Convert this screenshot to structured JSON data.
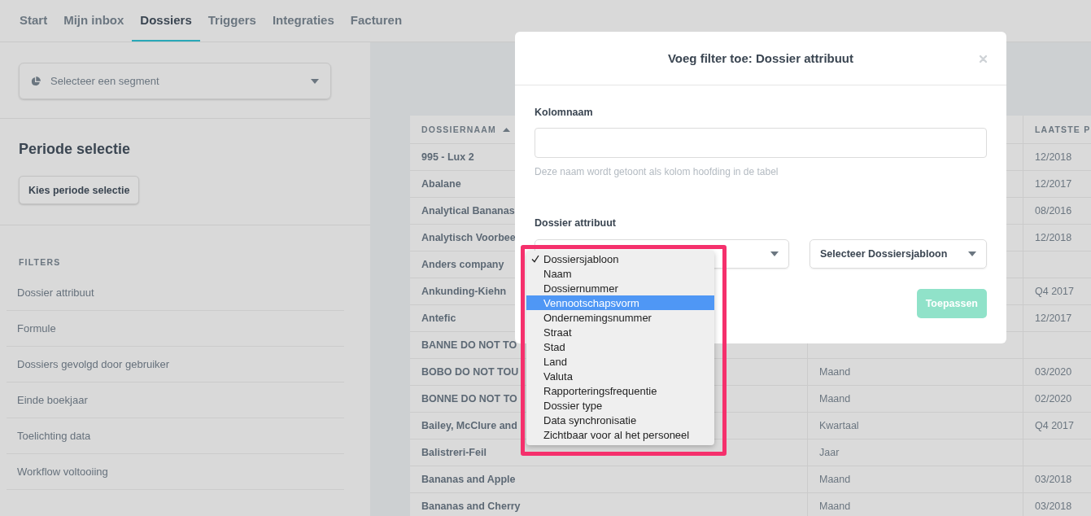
{
  "nav": {
    "tabs": [
      {
        "label": "Start",
        "selected": false
      },
      {
        "label": "Mijn inbox",
        "selected": false
      },
      {
        "label": "Dossiers",
        "selected": true
      },
      {
        "label": "Triggers",
        "selected": false
      },
      {
        "label": "Integraties",
        "selected": false
      },
      {
        "label": "Facturen",
        "selected": false
      }
    ]
  },
  "sidebar": {
    "segment_select": {
      "placeholder": "Selecteer een segment"
    },
    "period": {
      "title": "Periode selectie",
      "button": "Kies periode selectie"
    },
    "filters": {
      "title": "FILTERS",
      "items": [
        "Dossier attribuut",
        "Formule",
        "Dossiers gevolgd door gebruiker",
        "Einde boekjaar",
        "Toelichting data",
        "Workflow voltooiing"
      ]
    }
  },
  "table": {
    "columns": [
      {
        "label": "DOSSIERNAAM",
        "sorted": true
      },
      {
        "label": "LAATSTE P"
      }
    ],
    "rows": [
      {
        "dossiernaam": "995 - Lux 2",
        "column_3": "12/2018"
      },
      {
        "dossiernaam": "Abalane",
        "column_3": "12/2017"
      },
      {
        "dossiernaam": "Analytical Bananas",
        "column_3": "08/2016"
      },
      {
        "dossiernaam": "Analytisch Voorbee",
        "column_3": "12/2018"
      },
      {
        "dossiernaam": "Anders company"
      },
      {
        "dossiernaam": "Ankunding-Kiehn",
        "column_3": "Q4 2017"
      },
      {
        "dossiernaam": "Antefic",
        "column_3": "12/2017"
      },
      {
        "dossiernaam": "BANNE DO NOT TO"
      },
      {
        "dossiernaam": "BOBO DO NOT TOU",
        "column_2": "Maand",
        "column_3": "03/2020"
      },
      {
        "dossiernaam": "BONNE DO NOT TO",
        "column_2": "Maand",
        "column_3": "02/2020"
      },
      {
        "dossiernaam": "Bailey, McClure and",
        "column_2": "Kwartaal",
        "column_3": "Q4 2017"
      },
      {
        "dossiernaam": "Balistreri-Feil",
        "column_2": "Jaar"
      },
      {
        "dossiernaam": "Bananas and Apple",
        "column_2": "Maand",
        "column_3": "03/2018"
      },
      {
        "dossiernaam": "Bananas and Cherry",
        "column_2": "Maand",
        "column_3": "03/2018"
      }
    ]
  },
  "modal": {
    "title": "Voeg filter toe: Dossier attribuut",
    "name_field": {
      "label": "Kolomnaam",
      "help": "Deze naam wordt getoont als kolom hoofding in de tabel"
    },
    "attribute": {
      "label": "Dossier attribuut",
      "template_select": "Selecteer Dossiersjabloon"
    },
    "button": {
      "label": "Toepassen",
      "disabled": true
    }
  },
  "dropdown": {
    "options": [
      {
        "label": "Dossiersjabloon",
        "checked": true,
        "selected": false
      },
      {
        "label": "Naam",
        "checked": false,
        "selected": false
      },
      {
        "label": "Dossiernummer",
        "checked": false,
        "selected": false
      },
      {
        "label": "Vennootschapsvorm",
        "checked": false,
        "selected": true
      },
      {
        "label": "Ondernemingsnummer",
        "checked": false,
        "selected": false
      },
      {
        "label": "Straat",
        "checked": false,
        "selected": false
      },
      {
        "label": "Stad",
        "checked": false,
        "selected": false
      },
      {
        "label": "Land",
        "checked": false,
        "selected": false
      },
      {
        "label": "Valuta",
        "checked": false,
        "selected": false
      },
      {
        "label": "Rapporteringsfrequentie",
        "checked": false,
        "selected": false
      },
      {
        "label": "Dossier type",
        "checked": false,
        "selected": false
      },
      {
        "label": "Data synchronisatie",
        "checked": false,
        "selected": false
      },
      {
        "label": "Zichtbaar voor al het personeel",
        "checked": false,
        "selected": false
      }
    ]
  }
}
